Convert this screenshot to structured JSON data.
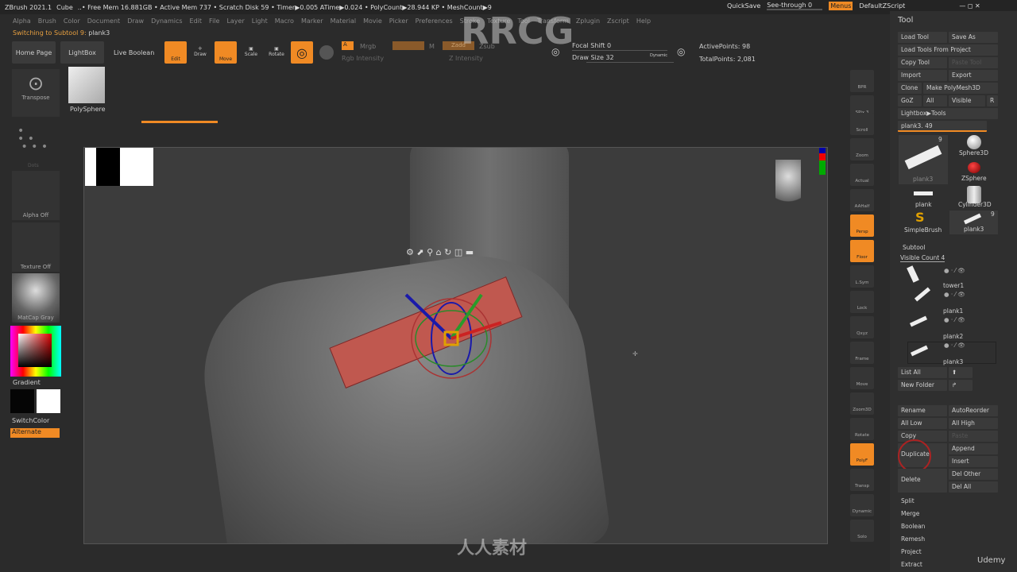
{
  "titlebar": {
    "app": "ZBrush 2021.1",
    "doc": "Cube",
    "stats": "..• Free Mem 16.881GB • Active Mem 737 • Scratch Disk 59 • Timer▶0.005 ATime▶0.024 • PolyCount▶28.944 KP • MeshCount▶9",
    "quicksave": "QuickSave",
    "seethrough": "See-through 0",
    "menus": "Menus",
    "script": "DefaultZScript"
  },
  "menus": [
    "Alpha",
    "Brush",
    "Color",
    "Document",
    "Draw",
    "Dynamics",
    "Edit",
    "File",
    "Layer",
    "Light",
    "Macro",
    "Marker",
    "Material",
    "Movie",
    "Picker",
    "Preferences",
    "Stroke",
    "Texture",
    "Tool",
    "Transform",
    "Zplugin",
    "Zscript",
    "Help"
  ],
  "status": {
    "label": "Switching to Subtool 9:",
    "value": "plank3"
  },
  "shelf": {
    "home": "Home Page",
    "lightbox": "LightBox",
    "liveboolean": "Live Boolean",
    "edit": "Edit",
    "draw": "Draw",
    "move": "Move",
    "scale": "Scale",
    "rotate": "Rotate",
    "a": "A",
    "mrgb": "Mrgb",
    "rgb": "Rgb",
    "m": "M",
    "zadd": "Zadd",
    "zsub": "Zsub",
    "rgbint": "Rgb Intensity",
    "zint": "Z Intensity",
    "focal": "Focal Shift 0",
    "drawsize": "Draw Size 32",
    "dynamic": "Dynamic",
    "active": "ActivePoints: 98",
    "total": "TotalPoints: 2,081"
  },
  "left": {
    "transpose": "Transpose",
    "polysphere": "PolySphere",
    "dots": "Dots",
    "alpha": "Alpha Off",
    "texture": "Texture Off",
    "matcap": "MatCap Gray",
    "gradient": "Gradient",
    "switch": "SwitchColor",
    "alternate": "Alternate"
  },
  "side": [
    "BPR",
    "SPix 3",
    "Scroll",
    "Zoom",
    "Actual",
    "AAHalf",
    "Persp",
    "Floor",
    "L.Sym",
    "Lock",
    "Qxyz",
    "Frame",
    "Move",
    "Zoom3D",
    "Rotate",
    "PolyF",
    "Transp",
    "Dynamic",
    "Solo"
  ],
  "tool": {
    "title": "Tool",
    "load": "Load Tool",
    "saveas": "Save As",
    "loadproj": "Load Tools From Project",
    "copy": "Copy Tool",
    "paste": "Paste Tool",
    "import": "Import",
    "export": "Export",
    "clone": "Clone",
    "make": "Make PolyMesh3D",
    "goz": "GoZ",
    "all": "All",
    "visible": "Visible",
    "r": "R",
    "lightbox": "Lightbox▶Tools",
    "current": "plank3. 49",
    "thumbs": [
      {
        "label": "plank3",
        "count": "9"
      },
      {
        "label": "Sphere3D"
      },
      {
        "label": "ZSphere"
      },
      {
        "label": "plank"
      },
      {
        "label": "Cylinder3D"
      },
      {
        "label": "SimpleBrush"
      },
      {
        "label": "plank3",
        "count": "9"
      }
    ]
  },
  "subtool": {
    "title": "Subtool",
    "visible": "Visible Count 4",
    "items": [
      "tower1",
      "plank1",
      "plank2",
      "plank3"
    ],
    "listall": "List All",
    "newfolder": "New Folder",
    "rename": "Rename",
    "autoreorder": "AutoReorder",
    "alllow": "All Low",
    "allhigh": "All High",
    "copy": "Copy",
    "paste": "Paste",
    "duplicate": "Duplicate",
    "append": "Append",
    "insert": "Insert",
    "delete": "Delete",
    "delother": "Del Other",
    "delall": "Del All",
    "split": "Split",
    "merge": "Merge",
    "boolean": "Boolean",
    "remesh": "Remesh",
    "project": "Project",
    "extract": "Extract"
  },
  "watermark": {
    "text": "RRCG",
    "cn": "人人素材",
    "udemy": "Udemy"
  }
}
